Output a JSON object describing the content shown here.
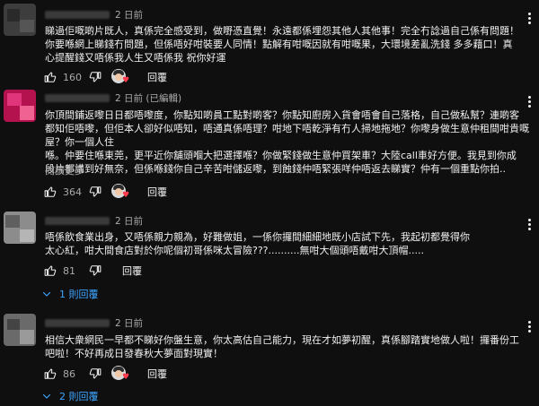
{
  "comments": [
    {
      "time": "2 日前",
      "text": "睇過佢嘅啲片既人，真係完全感受到，做嘢憑直覺！永遠都係埋怨其他人其他事！完全冇諗過自己係有問題！\n你要喺網上睇錢冇問題，但係唔好咁裝要人同情！點解有咁嘅因就有咁嘅果，大環境差亂洗錢 多多藉口！真\n心提醒錢又唔係我人生又唔係我 祝你好運",
      "likes": "160",
      "reply_label": "回覆",
      "avatar_colors": [
        "#5a5a5a",
        "#2a2a2a",
        "#8a8a8a"
      ]
    },
    {
      "time": "2 日前 (已編輯)",
      "text": "你頂間鋪返嚟日日都唔嚟度，你點知啲員工點對啲客？你點知廚房入貨會唔會自己落格，自己做私幫？連啲客\n都知佢唔嚟，但佢本人卻好似唔知，唔通真係唔理？咁地下唔乾淨有冇人掃地拖地？你嚟身做生意仲租間咁貴嘅屋？你一個人住\n喺。仲要住喺東莞，更平近你舖頭嗰大把選擇喺？你做緊錢做生意仲買架車？大陸call車好方便。我見到你成\n段片都講到好無奈，但係喺錢你自己辛苦咁儲返嚟，到蝕錢仲唔緊張咩仲唔返去睇實？仲有一個重點你拍..",
      "read_more": "閱讀更多",
      "likes": "364",
      "reply_label": "回覆",
      "avatar_colors": [
        "#c2185b",
        "#e91e63",
        "#f06292"
      ]
    },
    {
      "time": "2 日前",
      "text": "唔係飲食業出身，又唔係親力親為，好難做姐，一係你攞間細細地既小店試下先，我起初都覺得你\n太心紅，咁大間食店對於你呢個初哥係咪太冒險???..........無咁大個頭唔戴咁大頂帽.....",
      "likes": "81",
      "reply_label": "回覆",
      "replies": "1 則回覆",
      "avatar_colors": [
        "#9e9e9e",
        "#616161",
        "#bdbdbd"
      ]
    },
    {
      "time": "2 日前",
      "text": "相信大衆網民一早都不睇好你盤生意，你太高估自己能力，現在才如夢初醒，真係腳踏實地做人啦！攞番份工\n吧啦！不好再成日發春秋大夢面對現實！",
      "likes": "86",
      "reply_label": "回覆",
      "replies": "2 則回覆",
      "avatar_colors": [
        "#7a7a7a",
        "#4a4a4a",
        "#a0a0a0"
      ]
    }
  ],
  "icons": {
    "like": "thumb-up-icon",
    "dislike": "thumb-down-icon",
    "creator_heart": "creator-heart-icon",
    "more": "more-vert-icon",
    "expand": "chevron-down-icon"
  },
  "colors": {
    "background": "#0f0f0f",
    "text": "#f1f1f1",
    "secondary": "#aaaaaa",
    "link": "#3ea6ff",
    "heart": "#ff3b4e"
  }
}
